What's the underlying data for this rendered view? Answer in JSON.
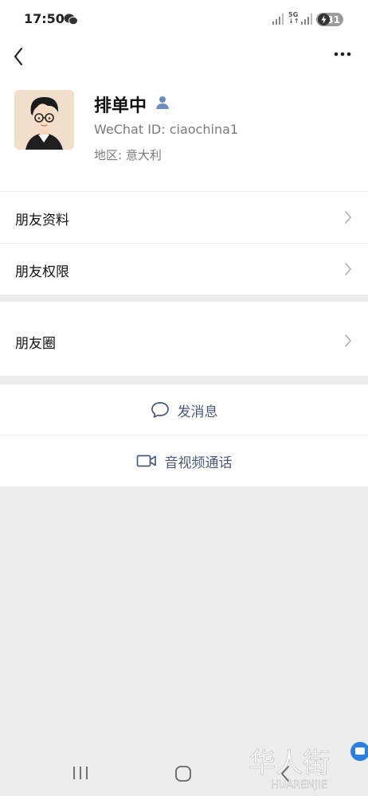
{
  "status_bar": {
    "time": "17:50",
    "network": "5G",
    "battery": "31"
  },
  "profile": {
    "name": "排单中",
    "wechat_id": "WeChat ID:  ciaochina1",
    "region": "地区:  意大利"
  },
  "menu": {
    "friend_info": "朋友资料",
    "friend_permissions": "朋友权限",
    "moments": "朋友圈"
  },
  "actions": {
    "send_message": "发消息",
    "video_call": "音视频通话"
  },
  "watermark": {
    "chinese": "华人街",
    "latin": "HUARENJIE"
  },
  "colors": {
    "accent_text": "#4b5a76",
    "background": "#ededed"
  }
}
